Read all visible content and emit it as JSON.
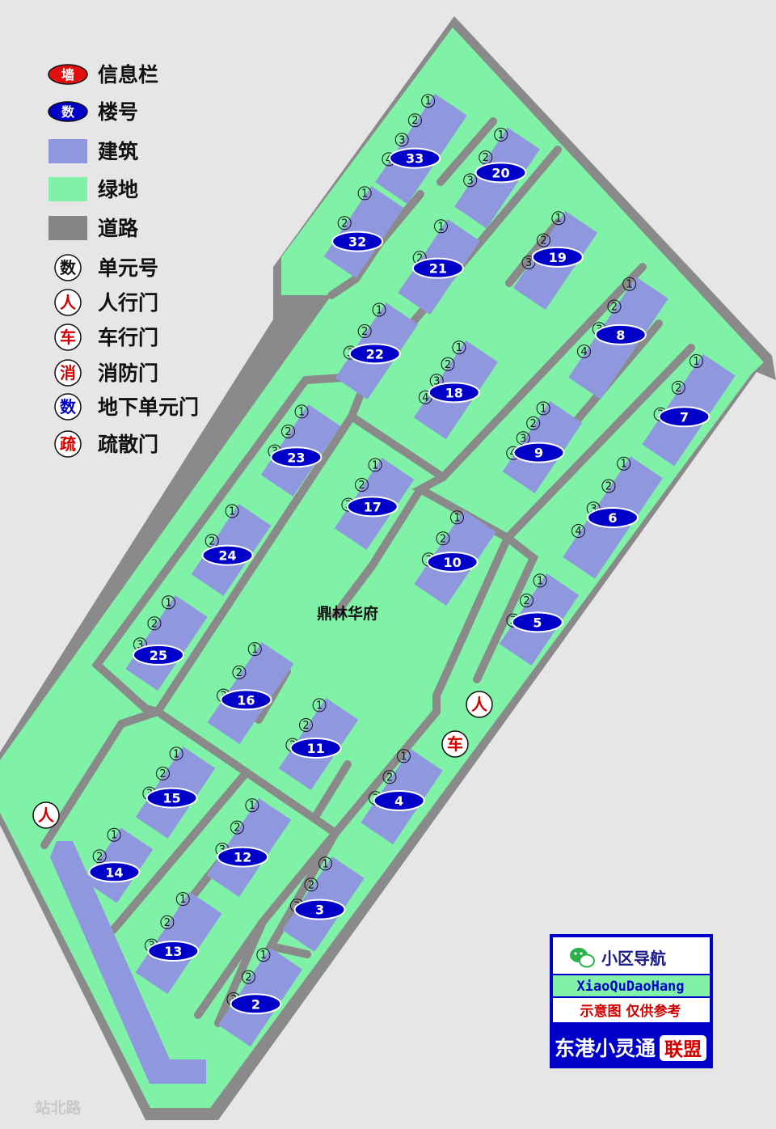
{
  "legend": [
    {
      "symbol": "墙",
      "label": "信息栏",
      "kind": "red-oval"
    },
    {
      "symbol": "数",
      "label": "楼号",
      "kind": "blue-oval"
    },
    {
      "symbol": "",
      "label": "建筑",
      "kind": "building-swatch"
    },
    {
      "symbol": "",
      "label": "绿地",
      "kind": "green-swatch"
    },
    {
      "symbol": "",
      "label": "道路",
      "kind": "road-swatch"
    },
    {
      "symbol": "数",
      "label": "单元号",
      "kind": "black-circle"
    },
    {
      "symbol": "人",
      "label": "人行门",
      "kind": "red-circle"
    },
    {
      "symbol": "车",
      "label": "车行门",
      "kind": "red-circle"
    },
    {
      "symbol": "消",
      "label": "消防门",
      "kind": "red-circle"
    },
    {
      "symbol": "数",
      "label": "地下单元门",
      "kind": "blue-circle"
    },
    {
      "symbol": "疏",
      "label": "疏散门",
      "kind": "red-circle"
    }
  ],
  "site_name": "鼎林华府",
  "street_name": "站北路",
  "gates": [
    {
      "label": "人",
      "type": "pedestrian"
    },
    {
      "label": "车",
      "type": "vehicle"
    },
    {
      "label": "人",
      "type": "pedestrian"
    }
  ],
  "buildings": [
    {
      "number": "33",
      "units": [
        "1",
        "2",
        "3",
        "4"
      ]
    },
    {
      "number": "20",
      "units": [
        "1",
        "2",
        "3"
      ]
    },
    {
      "number": "32",
      "units": [
        "1",
        "2"
      ]
    },
    {
      "number": "21",
      "units": [
        "1",
        "2"
      ]
    },
    {
      "number": "19",
      "units": [
        "1",
        "2",
        "3"
      ]
    },
    {
      "number": "8",
      "units": [
        "1",
        "2",
        "3",
        "4"
      ]
    },
    {
      "number": "22",
      "units": [
        "1",
        "2",
        "3"
      ]
    },
    {
      "number": "18",
      "units": [
        "1",
        "2",
        "3",
        "4"
      ]
    },
    {
      "number": "7",
      "units": [
        "1",
        "2",
        "3"
      ]
    },
    {
      "number": "9",
      "units": [
        "1",
        "2",
        "3",
        "4"
      ]
    },
    {
      "number": "23",
      "units": [
        "1",
        "2",
        "3"
      ]
    },
    {
      "number": "17",
      "units": [
        "1",
        "2",
        "3"
      ]
    },
    {
      "number": "6",
      "units": [
        "1",
        "2",
        "3",
        "4"
      ]
    },
    {
      "number": "10",
      "units": [
        "1",
        "2",
        "3"
      ]
    },
    {
      "number": "24",
      "units": [
        "1",
        "2"
      ]
    },
    {
      "number": "5",
      "units": [
        "1",
        "2",
        "3"
      ]
    },
    {
      "number": "25",
      "units": [
        "1",
        "2",
        "3"
      ]
    },
    {
      "number": "16",
      "units": [
        "1",
        "2",
        "3"
      ]
    },
    {
      "number": "11",
      "units": [
        "1",
        "2",
        "3"
      ]
    },
    {
      "number": "15",
      "units": [
        "1",
        "2",
        "3"
      ]
    },
    {
      "number": "4",
      "units": [
        "1",
        "2",
        "3"
      ]
    },
    {
      "number": "12",
      "units": [
        "1",
        "2",
        "3"
      ]
    },
    {
      "number": "14",
      "units": [
        "1",
        "2"
      ]
    },
    {
      "number": "3",
      "units": [
        "1",
        "2",
        "3"
      ]
    },
    {
      "number": "13",
      "units": [
        "1",
        "2",
        "3"
      ]
    },
    {
      "number": "2",
      "units": [
        "1",
        "2",
        "3"
      ]
    }
  ],
  "brand": {
    "app_title": "小区导航",
    "url_text": "XiaoQuDaoHang",
    "note": "示意图 仅供参考",
    "name": "东港小灵通",
    "tag": "联盟"
  },
  "colors": {
    "background": "#e6e6e6",
    "green": "#80f2a8",
    "road": "#8a8a8a",
    "building": "#8f98de",
    "building_label": "#0000c8",
    "gate_red": "#d40000",
    "brand_blue": "#0000c8"
  }
}
